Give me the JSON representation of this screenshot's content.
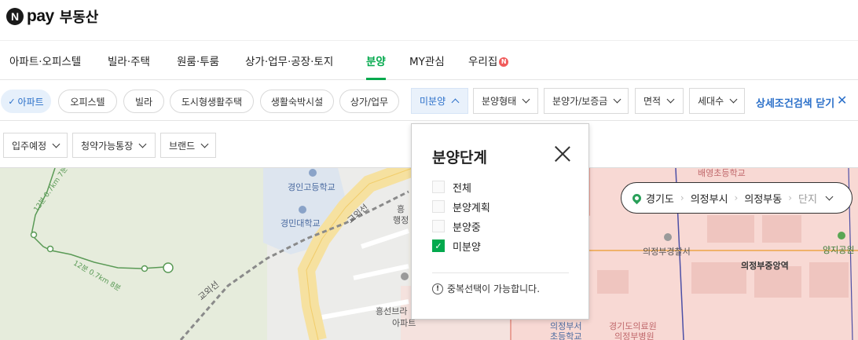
{
  "header": {
    "logo_letter": "N",
    "logo_pay": "pay",
    "title": "부동산"
  },
  "nav": {
    "items": [
      {
        "label": "아파트·오피스텔"
      },
      {
        "label": "빌라·주택"
      },
      {
        "label": "원룸·투룸"
      },
      {
        "label": "상가·업무·공장·토지"
      },
      {
        "label": "분양",
        "active": true
      },
      {
        "label": "MY관심"
      },
      {
        "label": "우리집",
        "badge": "N"
      }
    ]
  },
  "filters": {
    "types": [
      {
        "label": "아파트",
        "active": true
      },
      {
        "label": "오피스텔"
      },
      {
        "label": "빌라"
      },
      {
        "label": "도시형생활주택"
      },
      {
        "label": "생활숙박시설"
      },
      {
        "label": "상가/업무"
      }
    ],
    "dropdowns": [
      {
        "label": "미분양",
        "open": true
      },
      {
        "label": "분양형태"
      },
      {
        "label": "분양가/보증금"
      },
      {
        "label": "면적"
      },
      {
        "label": "세대수"
      }
    ],
    "advanced_toggle": "상세조건검색 닫기",
    "row2": [
      {
        "label": "입주예정"
      },
      {
        "label": "청약가능통장"
      },
      {
        "label": "브랜드"
      }
    ]
  },
  "popup": {
    "title": "분양단계",
    "options": [
      {
        "label": "전체",
        "checked": false
      },
      {
        "label": "분양계획",
        "checked": false
      },
      {
        "label": "분양중",
        "checked": false
      },
      {
        "label": "미분양",
        "checked": true
      }
    ],
    "note": "중복선택이 가능합니다.",
    "checkmark": "✓"
  },
  "location": {
    "province": "경기도",
    "city": "의정부시",
    "district": "의정부동",
    "complex": "단지"
  },
  "map_labels": {
    "school1": "경인고등학교",
    "school2": "경민대학교",
    "road": "교외선",
    "trail": "12분 0.7km 8분",
    "trail_top": "12분 0.7km 7분",
    "stop1": "흥",
    "stop2": "행정",
    "apt": "흥선브라",
    "apt2": "아파트",
    "school3": "배영초등학교",
    "police": "의정부경찰서",
    "station": "의정부중앙역",
    "park": "양지공원",
    "school4": "의정부서",
    "school4b": "초등학교",
    "hospital": "경기도의료원",
    "hospital2": "의정부병원"
  },
  "colors": {
    "accent_green": "#03a94d",
    "accent_blue": "#2a6fc9",
    "zone_pink": "#f8d9d4"
  }
}
